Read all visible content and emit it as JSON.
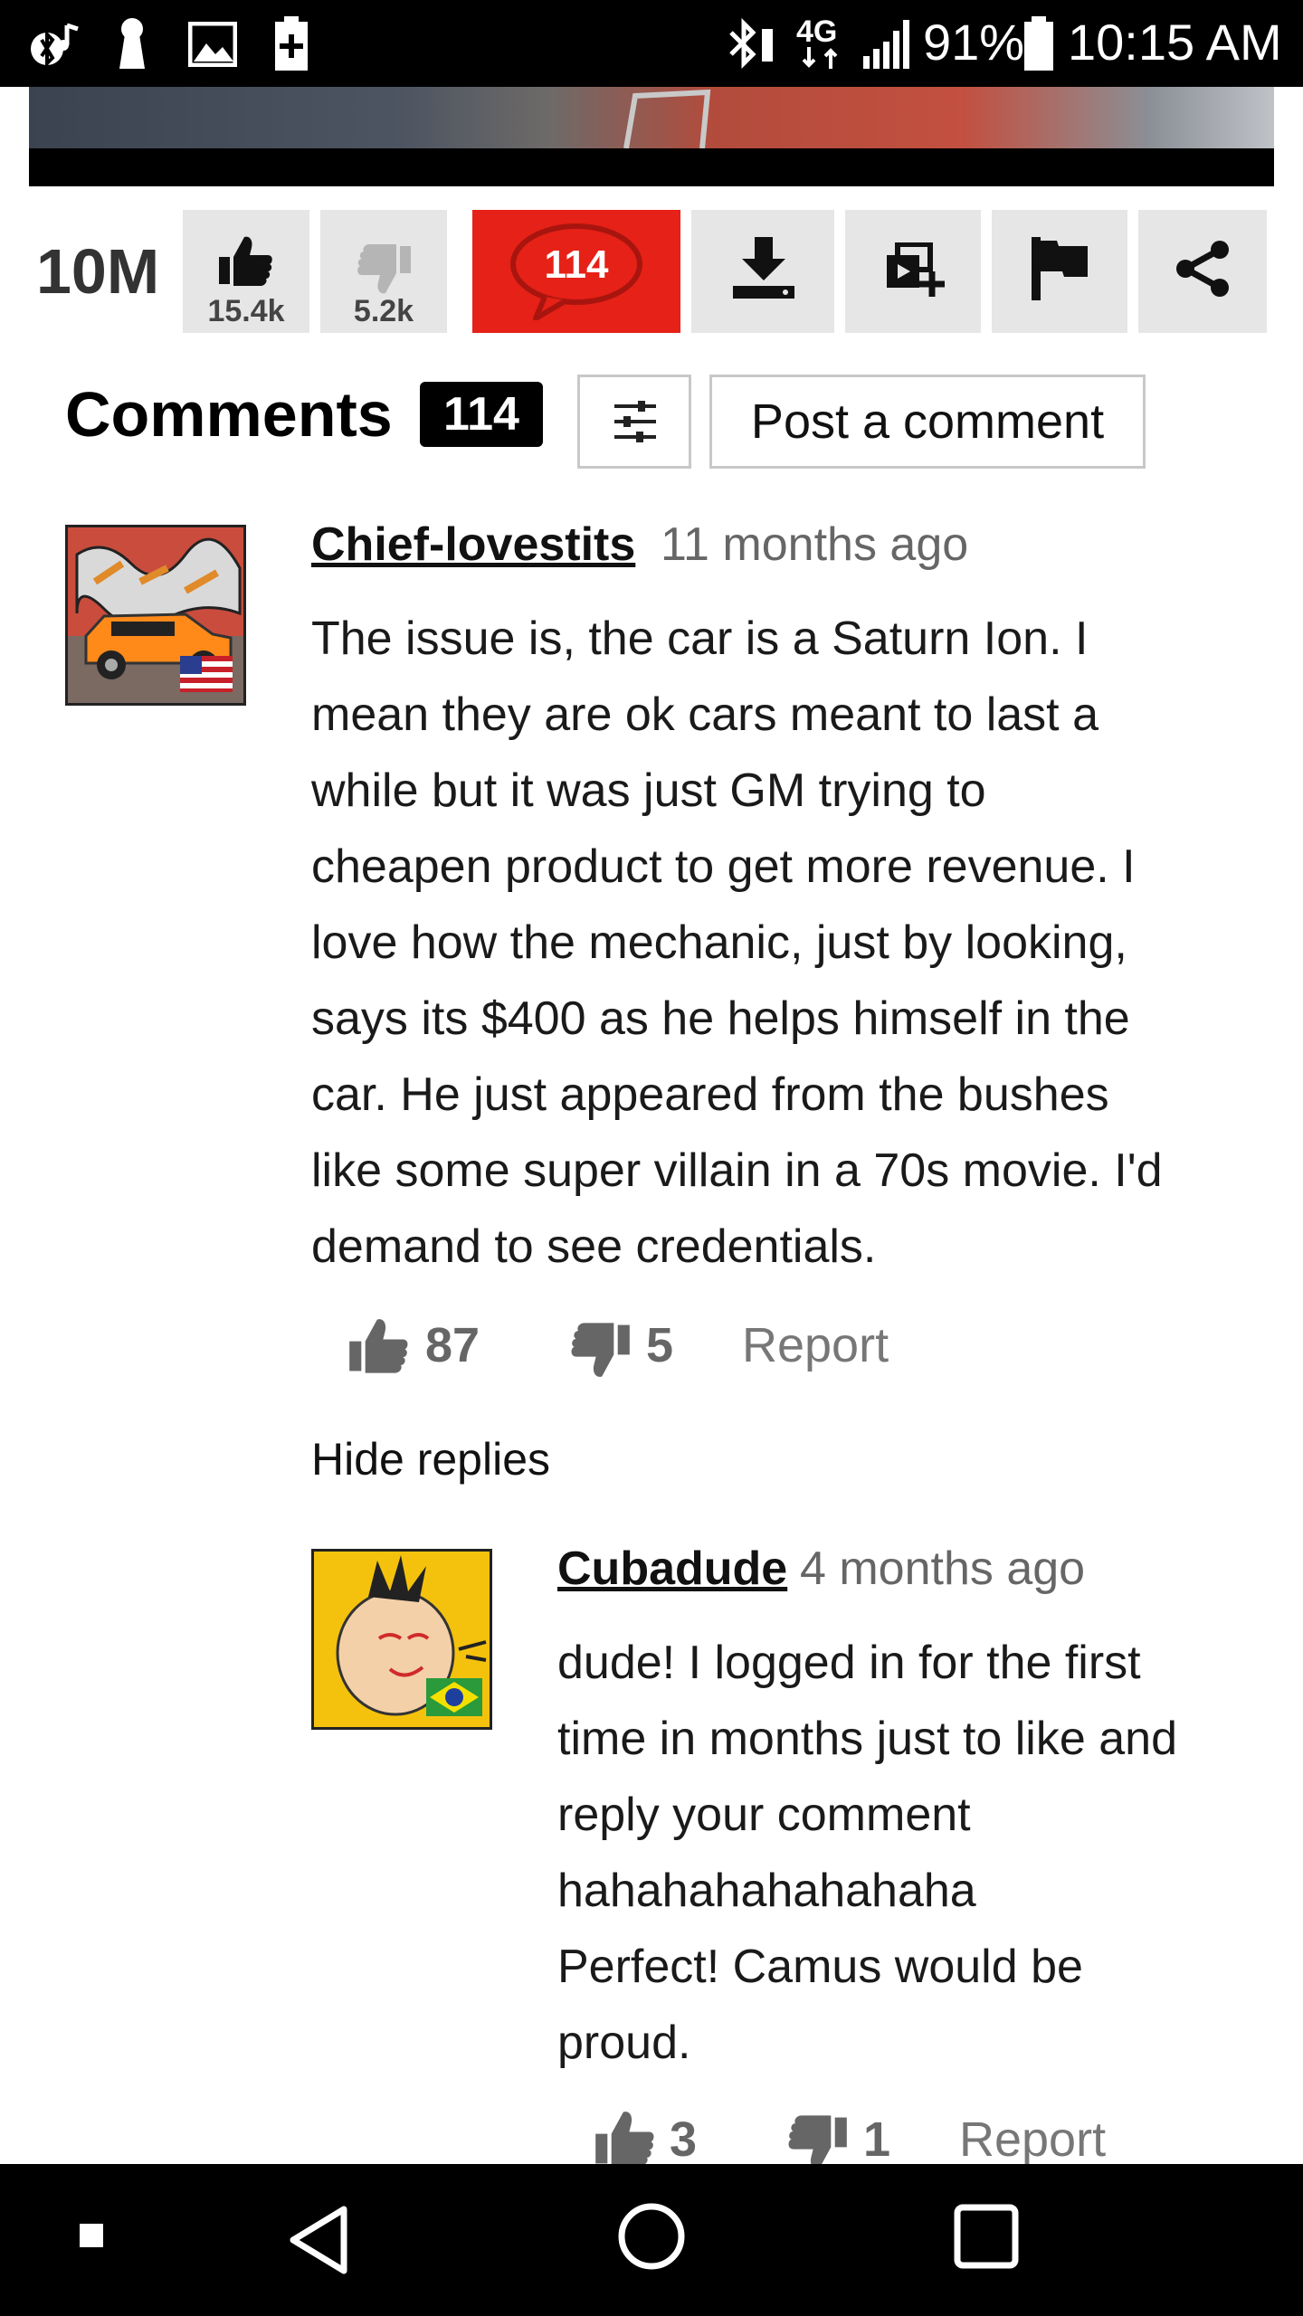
{
  "status_bar": {
    "battery": "91%",
    "time": "10:15 AM",
    "network": "4G",
    "icons": [
      "bluetooth-music-icon",
      "keyhole-icon",
      "image-icon",
      "battery-plus-icon",
      "bluetooth-icon",
      "lte-icon",
      "signal-icon",
      "battery-icon"
    ]
  },
  "actions": {
    "views": "10M",
    "likes": "15.4k",
    "dislikes": "5.2k",
    "comment_count": "114",
    "icons": [
      "thumbs-up-icon",
      "thumbs-down-icon",
      "speech-bubble-icon",
      "download-icon",
      "add-to-playlist-icon",
      "flag-icon",
      "share-icon"
    ]
  },
  "comments_header": {
    "title": "Comments",
    "count": "114",
    "post_label": "Post a comment",
    "filter_icon": "sliders-icon"
  },
  "comments": [
    {
      "author": "Chief-lovestits",
      "age": "11 months ago",
      "lines": [
        "The issue is, the car is a Saturn Ion. I",
        "mean they are ok cars meant to last a",
        "while but it was just GM trying to",
        "cheapen product to get more revenue. I",
        "love how the mechanic, just by looking,",
        "says its $400 as he helps himself in the",
        "car. He just appeared from the bushes",
        "like some super villain in a 70s movie. I'd",
        "demand to see credentials."
      ],
      "likes": "87",
      "dislikes": "5",
      "report": "Report",
      "hide_replies": "Hide replies"
    }
  ],
  "reply": {
    "author": "Cubadude",
    "age": "4 months ago",
    "lines": [
      "dude! I logged in for the first",
      "time in months just to like and",
      "reply your comment",
      "hahahahahahahaha",
      "Perfect! Camus would be",
      "proud."
    ],
    "likes": "3",
    "dislikes": "1",
    "report": "Report"
  },
  "nav_bar": {
    "icons": [
      "small-square-icon",
      "back-icon",
      "home-icon",
      "recents-icon"
    ]
  },
  "colors": {
    "accent_red": "#e62117",
    "button_gray": "#e6e6e6"
  }
}
